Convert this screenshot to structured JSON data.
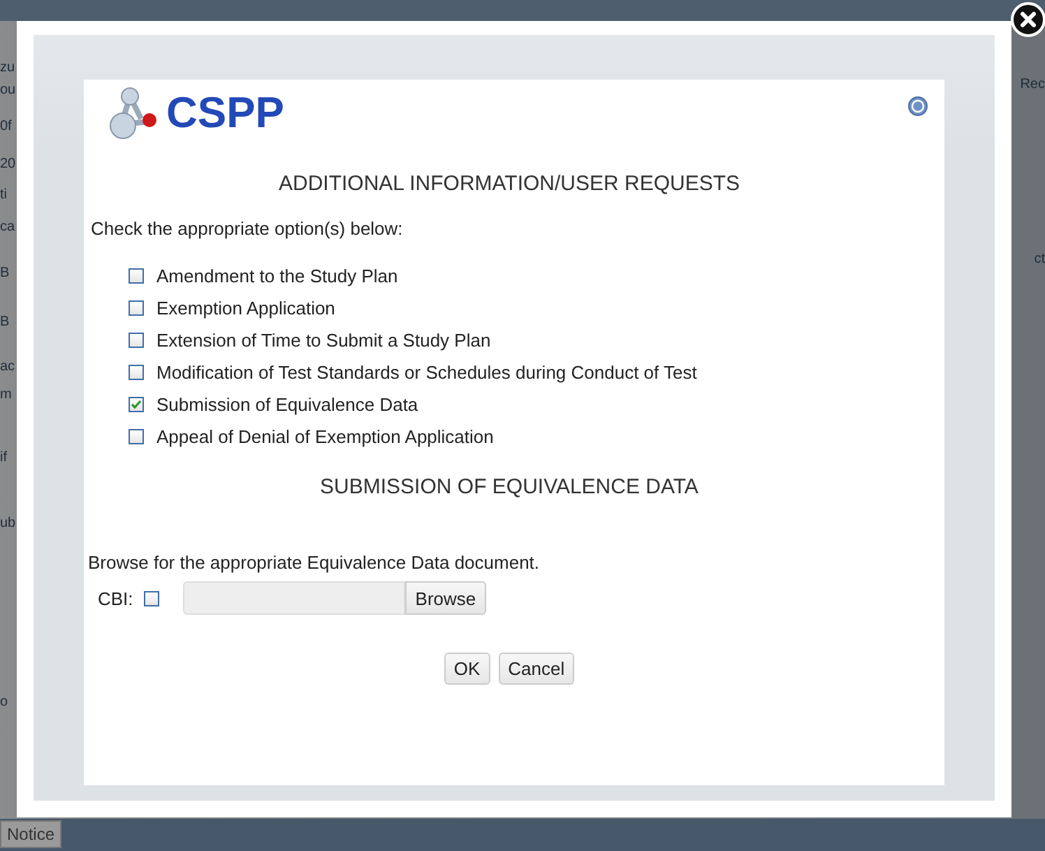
{
  "background": {
    "left_fragments": [
      {
        "text": "zu"
      },
      {
        "text": "ou"
      },
      {
        "text": "0f"
      },
      {
        "text": "20"
      },
      {
        "text": "ti"
      },
      {
        "text": "ca"
      },
      {
        "text": "B"
      },
      {
        "text": "B"
      },
      {
        "text": "ac"
      },
      {
        "text": "m"
      },
      {
        "text": "if"
      },
      {
        "text": "ub"
      },
      {
        "text": "o"
      }
    ],
    "right_fragments": [
      "Rec",
      "ct"
    ],
    "notice_button": "Notice"
  },
  "dialog": {
    "logo": "CSPP",
    "heading": "ADDITIONAL INFORMATION/USER REQUESTS",
    "instruction": "Check the appropriate option(s) below:",
    "options": [
      {
        "label": "Amendment to the Study Plan",
        "checked": false
      },
      {
        "label": "Exemption Application",
        "checked": false
      },
      {
        "label": "Extension of Time to Submit a Study Plan",
        "checked": false
      },
      {
        "label": "Modification of Test Standards or Schedules during Conduct of Test",
        "checked": false
      },
      {
        "label": "Submission of Equivalence Data",
        "checked": true
      },
      {
        "label": "Appeal of Denial of Exemption Application",
        "checked": false
      }
    ],
    "section_heading": "SUBMISSION OF EQUIVALENCE DATA",
    "browse_prompt": "Browse for the appropriate Equivalence Data document.",
    "cbi": {
      "label": "CBI:",
      "checked": false
    },
    "browse_button": "Browse",
    "buttons": [
      "OK",
      "Cancel"
    ]
  }
}
